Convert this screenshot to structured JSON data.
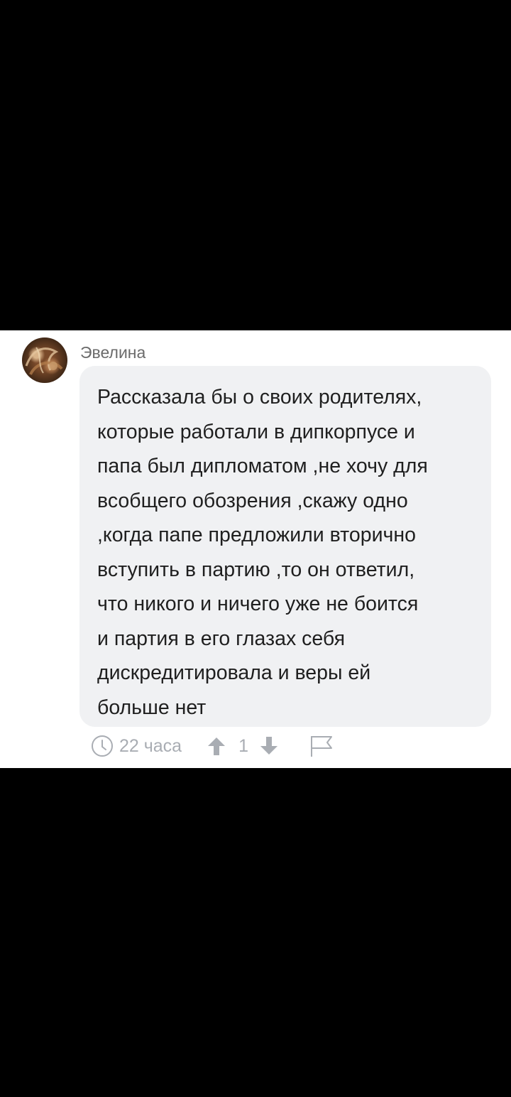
{
  "comment": {
    "author": "Эвелина",
    "text": "Рассказала бы о своих родителях,\nкоторые работали в дипкорпусе и\nпапа был дипломатом ,не хочу для\nвсобщего обозрения ,скажу одно\n,когда папе предложили вторично\nвступить в партию ,то он ответил,\nчто никого и ничего уже не боится\nи партия в его глазах себя\nдискредитировала и веры ей\nбольше нет",
    "time": "22 часа",
    "score": "1"
  },
  "icons": {
    "clock": "clock-icon",
    "upvote": "arrow-up-icon",
    "downvote": "arrow-down-icon",
    "report": "flag-icon"
  },
  "colors": {
    "background": "#000000",
    "panel": "#ffffff",
    "bubble": "#f0f1f3",
    "text": "#1f1f1f",
    "author": "#6b6b6b",
    "meta": "#a9adb3"
  }
}
